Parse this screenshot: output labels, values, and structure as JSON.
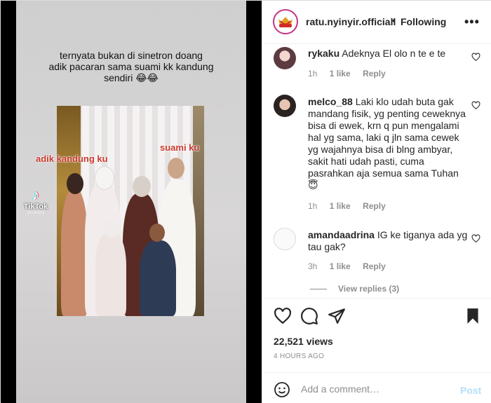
{
  "media": {
    "caption_lines": [
      "ternyata bukan di sinetron doang",
      "adik pacaran sama suami kk kandung",
      "sendiri 😂😂"
    ],
    "label_left": "adik kandung ku",
    "label_right": "suami ku",
    "tiktok_text": "TikTok",
    "tiktok_handle": "@rdeality"
  },
  "header": {
    "username": "ratu.nyinyir.officiall",
    "separator": "•",
    "follow_status": "Following",
    "more": "•••"
  },
  "comments": [
    {
      "user": "rykaku",
      "text": "Adeknya El olo n te e te",
      "time": "1h",
      "likes": "1 like",
      "reply": "Reply"
    },
    {
      "user": "melco_88",
      "text": "Laki klo udah buta gak mandang fisik, yg penting ceweknya bisa di ewek, krn q pun mengalami hal yg sama, laki q jln sama cewek yg wajahnya bisa di blng ambyar, sakit hati udah pasti, cuma pasrahkan aja semua sama Tuhan 😇",
      "time": "1h",
      "likes": "1 like",
      "reply": "Reply"
    },
    {
      "user": "amandaadrina",
      "text": "IG ke tiganya ada yg tau gak?",
      "time": "3h",
      "likes": "1 like",
      "reply": "Reply"
    }
  ],
  "view_replies": "View replies (3)",
  "stats": {
    "views": "22,521 views",
    "time_ago": "4 HOURS AGO"
  },
  "add_comment": {
    "placeholder": "Add a comment…",
    "post_label": "Post"
  },
  "colors": {
    "link_disabled": "#b2dffc",
    "secondary_text": "#8e8e8e",
    "label_red": "#c8392d"
  }
}
